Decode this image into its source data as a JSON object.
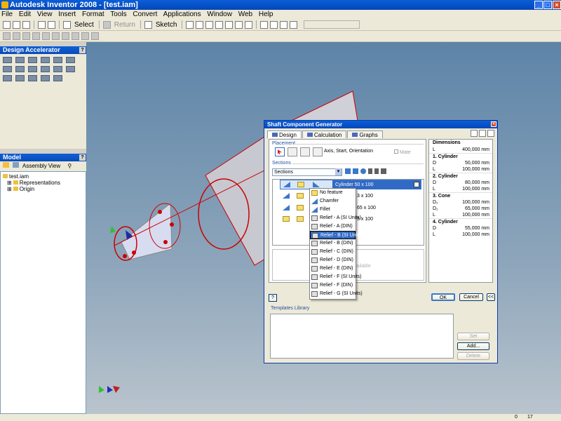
{
  "app": {
    "title": "Autodesk Inventor 2008 - [test.iam]"
  },
  "menu": [
    "File",
    "Edit",
    "View",
    "Insert",
    "Format",
    "Tools",
    "Convert",
    "Applications",
    "Window",
    "Web",
    "Help"
  ],
  "toolbar": {
    "select_label": "Select",
    "return_label": "Return",
    "sketch_label": "Sketch"
  },
  "design_accelerator": {
    "title": "Design Accelerator"
  },
  "model": {
    "title": "Model",
    "view_label": "Assembly View",
    "tree": [
      "test.iam",
      "Representations",
      "Origin"
    ]
  },
  "status": {
    "val1": "0",
    "val2": "17"
  },
  "dialog": {
    "title": "Shaft Component Generator",
    "tabs": [
      "Design",
      "Calculation",
      "Graphs"
    ],
    "placement_label": "Placement",
    "placement_text": "Axis, Start, Orientation",
    "mate_label": "Mate",
    "sections_label": "Sections",
    "sections_value": "Sections",
    "selected_section": "Cylinder 50 x 100",
    "rows": [
      "3 x 100",
      "65 x 100",
      "5 x 100"
    ],
    "desc_hint": "vailable",
    "ok": "OK",
    "cancel": "Cancel",
    "more": "<<",
    "templates_label": "Templates Library",
    "set": "Set",
    "add": "Add...",
    "delete": "Delete"
  },
  "properties": {
    "header": "Dimensions",
    "L_overall_key": "L",
    "L_overall": "400,000 mm",
    "groups": [
      {
        "title": "1. Cylinder",
        "rows": [
          {
            "k": "D",
            "v": "50,000 mm"
          },
          {
            "k": "L",
            "v": "100,000 mm"
          }
        ]
      },
      {
        "title": "2. Cylinder",
        "rows": [
          {
            "k": "D",
            "v": "80,000 mm"
          },
          {
            "k": "L",
            "v": "100,000 mm"
          }
        ]
      },
      {
        "title": "3. Cone",
        "rows": [
          {
            "k": "D₁",
            "v": "100,000 mm"
          },
          {
            "k": "D₂",
            "v": "65,000 mm"
          },
          {
            "k": "L",
            "v": "100,000 mm"
          }
        ]
      },
      {
        "title": "4. Cylinder",
        "rows": [
          {
            "k": "D",
            "v": "55,000 mm"
          },
          {
            "k": "L",
            "v": "100,000 mm"
          }
        ]
      }
    ]
  },
  "dropdown": {
    "items": [
      {
        "label": "No feature",
        "icon": "cylinder"
      },
      {
        "label": "Chamfer",
        "icon": "triangle"
      },
      {
        "label": "Fillet",
        "icon": "triangle"
      },
      {
        "label": "Relief - A (SI Units)",
        "icon": "dim"
      },
      {
        "label": "Relief - A (DIN)",
        "icon": "dim"
      },
      {
        "label": "Relief - B (SI Units)",
        "icon": "dim"
      },
      {
        "label": "Relief - B (DIN)",
        "icon": "dim"
      },
      {
        "label": "Relief - C (DIN)",
        "icon": "dim"
      },
      {
        "label": "Relief - D (DIN)",
        "icon": "dim"
      },
      {
        "label": "Relief - E (DIN)",
        "icon": "dim"
      },
      {
        "label": "Relief - F (SI Units)",
        "icon": "dim"
      },
      {
        "label": "Relief - F (DIN)",
        "icon": "dim"
      },
      {
        "label": "Relief - G (SI Units)",
        "icon": "dim"
      }
    ],
    "highlighted_index": 5
  }
}
